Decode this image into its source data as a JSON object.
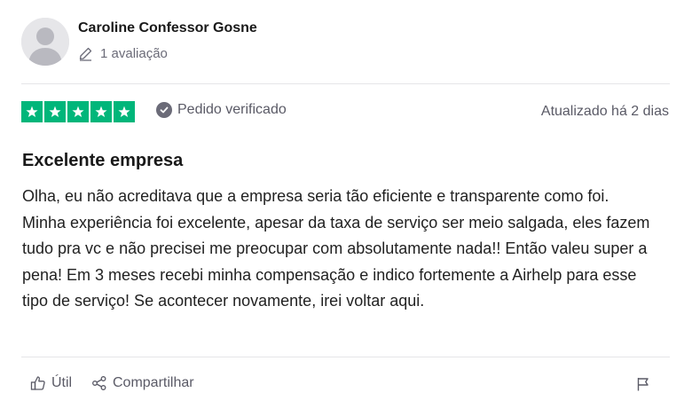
{
  "reviewer": {
    "name": "Caroline Confessor Gosne",
    "review_count": "1 avaliação"
  },
  "rating": {
    "stars": 5,
    "max_stars": 5,
    "star_color": "#00b67a"
  },
  "verified_label": "Pedido verificado",
  "date": "Atualizado há 2 dias",
  "review": {
    "title": "Excelente empresa",
    "body": "Olha, eu não acreditava que a empresa seria tão eficiente e transparente como foi. Minha experiência foi excelente, apesar da taxa de serviço ser meio salgada, eles fazem tudo pra vc e não precisei me preocupar com absolutamente nada!! Então valeu super a pena! Em 3 meses recebi minha compensação e indico fortemente a Airhelp para esse tipo de serviço! Se acontecer novamente, irei voltar aqui."
  },
  "actions": {
    "useful_label": "Útil",
    "share_label": "Compartilhar"
  },
  "icons": {
    "avatar": "user-silhouette-icon",
    "review_count": "pencil-icon",
    "verified": "checkmark-circle-icon",
    "useful": "thumbs-up-icon",
    "share": "share-icon",
    "report": "flag-icon"
  }
}
